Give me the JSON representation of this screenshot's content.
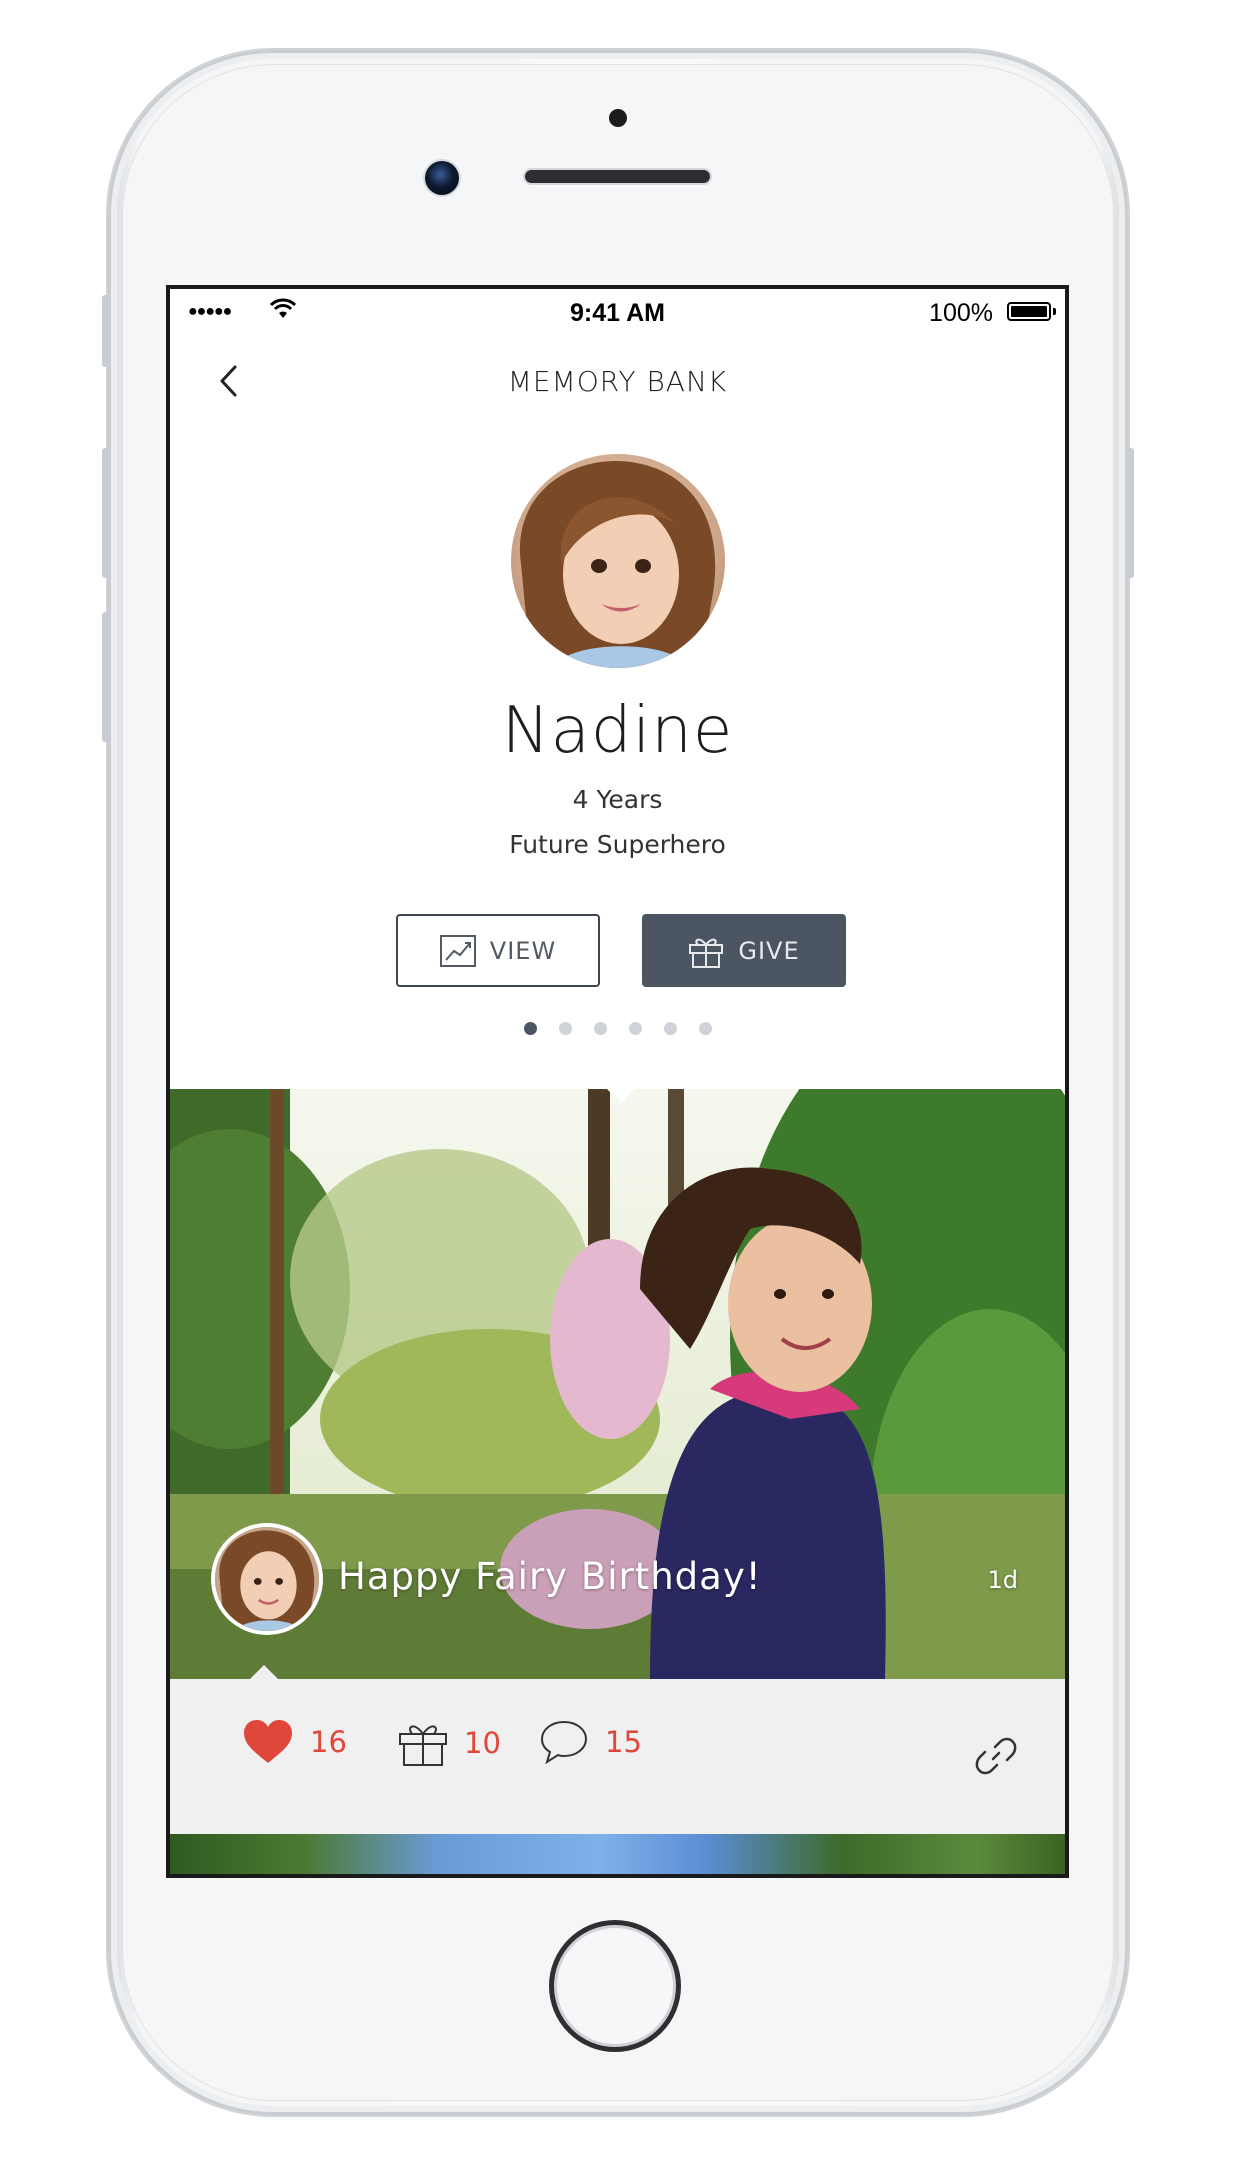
{
  "status_bar": {
    "signal": "●●●●●",
    "time": "9:41 AM",
    "battery": "100%"
  },
  "nav": {
    "title": "MEMORY BANK"
  },
  "profile": {
    "name": "Nadine",
    "age": "4 Years",
    "title": "Future Superhero"
  },
  "buttons": {
    "view": "VIEW",
    "give": "GIVE"
  },
  "pager": {
    "count": 6,
    "active_index": 0
  },
  "post": {
    "caption": "Happy Fairy Birthday!",
    "age": "1d"
  },
  "actions": {
    "likes": "16",
    "gifts": "10",
    "comments": "15"
  },
  "colors": {
    "accent": "#e0473b",
    "dark_button": "#4c5562"
  }
}
